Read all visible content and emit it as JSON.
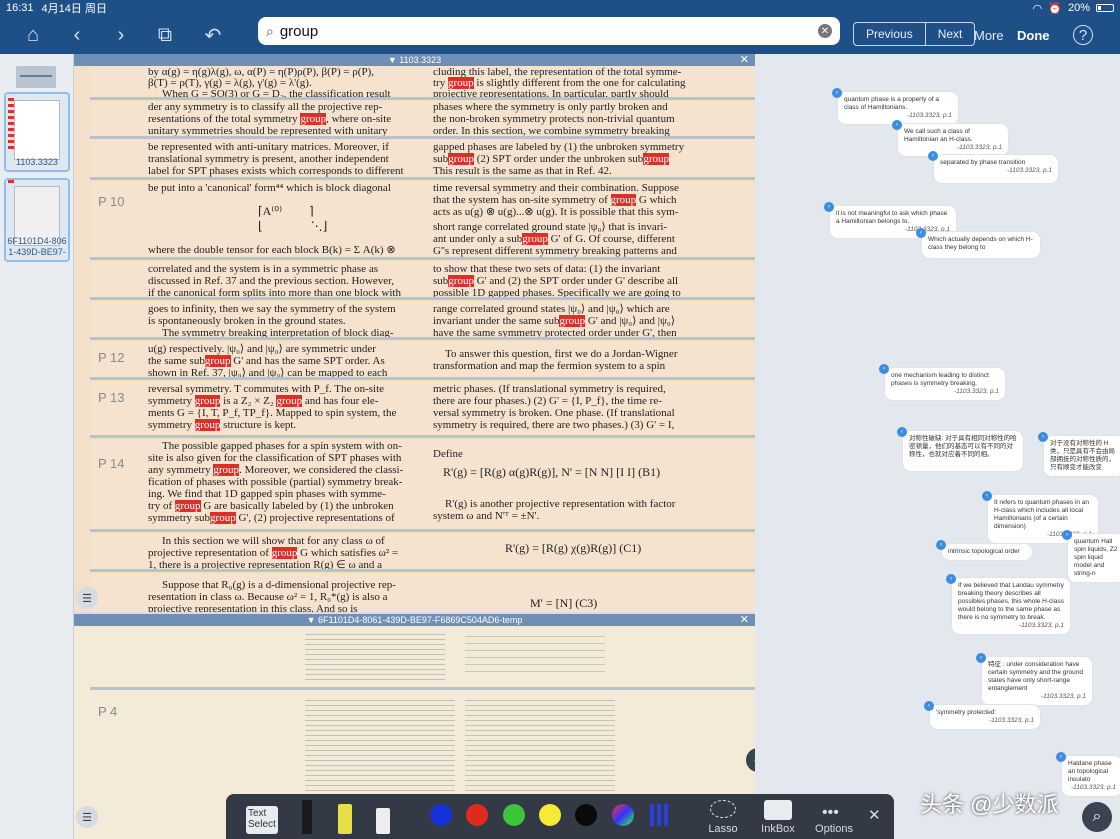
{
  "status": {
    "time": "16:31",
    "date": "4月14日 周日",
    "battery": "20%"
  },
  "toolbar": {
    "search_query": "group",
    "prev": "Previous",
    "next": "Next",
    "more": "More",
    "done": "Done"
  },
  "thumbs": [
    {
      "label": "1103.3323"
    },
    {
      "label": "6F1101D4-8061-439D-BE97-"
    }
  ],
  "pane1": {
    "title": "1103.3323"
  },
  "pane2": {
    "title": "6F1101D4-8061-439D-BE97-F6869C504AD6-temp"
  },
  "pages": {
    "p10": "P 10",
    "p12": "P 12",
    "p13": "P 13",
    "p14": "P 14",
    "p4": "P 4"
  },
  "pdf": {
    "s1a": "by α(g) = η(g)λ(g), ω, α(P) = η(P)ρ(P), β(P) = ρ(P),",
    "s1b": "β(T) = ρ(T), γ(g) = λ(g), γ'(g) = λ'(g).",
    "s1c": "When G = SO(3) or G = D₂, the classification result",
    "s2a": "der any symmetry is to classify all the projective rep-",
    "s2b": "resentations of the total symmetry",
    "s2b2": ", where on-site",
    "s2c": "unitary symmetries should be represented with unitary",
    "s3a": "be represented with anti-unitary matrices. Moreover, if",
    "s3b": "translational symmetry is present, another independent",
    "s3c": "label for SPT phases exists which corresponds to different",
    "s4a": "be put into a 'canonical' form⁴⁴ which is block diagonal",
    "s5a": "where the double tensor for each block B(k) = Σ A(k) ⊗",
    "s6a": "correlated and the system is in a symmetric phase as",
    "s6b": "discussed in Ref. 37 and the previous section. However,",
    "s6c": "if the canonical form splits into more than one block with",
    "s7a": "goes to infinity, then we say the symmetry of the system",
    "s7b": "is spontaneously broken in the ground states.",
    "s7c": "The symmetry breaking interpretation of block diag-",
    "s8a": "u(g) respectively. |ψ₀⟩ and |ψ₀⟩ are symmetric under",
    "s8b": "the same sub",
    "s8b2": " G' and has the same SPT order. As",
    "s8c": "shown in Ref. 37, |ψ₀⟩ and |ψ₀⟩ can be mapped to each",
    "s9a": "reversal symmetry.  T commutes with P_f. The on-site",
    "s9b": "symmetry",
    "s9b2": "is a Z₂ × Z₂",
    "s9b3": "and has four ele-",
    "s9c": "ments G = {I, T, P_f, TP_f}. Mapped to spin system, the",
    "s9d": "symmetry",
    "s9d2": "structure is kept.",
    "s9e": "The possible gapped phases for a spin system with on-",
    "s10a": "site is also given for the classification of SPT phases with",
    "s10b": "any symmetry",
    "s10b2": ". Moreover, we considered the classi-",
    "s10c": "fication of phases with possible (partial) symmetry break-",
    "s10d": "ing. We find that 1D gapped spin phases with symme-",
    "s10e": "try of",
    "s10e2": "G are basically labeled by (1) the unbroken",
    "s10f": "symmetry sub",
    "s10f2": "G', (2) projective representations of",
    "s10g": "G'. Note that in calculating projective representations of",
    "s11a": "In this section we will show that for any class ω of",
    "s11b": "projective representation of",
    "s11b2": "G which satisfies ω² =",
    "s11c": "1, there is a projective representation R(g) ∈ ω and a",
    "s12a": "Suppose that R₀(g) is a d-dimensional projective rep-",
    "s12b": "resentation in class ω. Because ω² = 1, R₀*(g) is also a",
    "s12c": "projective representation in this class. And so is",
    "r1a": "try",
    "r1a2": "is slightly different from the one for calculating",
    "r1b": "projective representations. In particular, partly should",
    "r2a": "phases where the symmetry is only partly broken and",
    "r2b": "the non-broken symmetry protects non-trivial quantum",
    "r2c": "order. In this section, we combine symmetry breaking",
    "r3a": "gapped phases are labeled by (1) the unbroken symmetry",
    "r3b": "sub",
    "r3b2": "(2) SPT order under the unbroken sub",
    "r3c": "This result is the same as that in Ref. 42.",
    "r4a": "time reversal symmetry and their combination. Suppose",
    "r4b": "that the system has on-site symmetry of",
    "r4b2": "G which",
    "r4c": "acts as u(g) ⊗ u(g)...⊗ u(g). It is possible that this sym-",
    "r5a": "short range correlated ground state |ψ₀⟩ that is invari-",
    "r5b": "ant under only a sub",
    "r5b2": "G' of G. Of course, different",
    "r5c": "G''s represent different symmetry breaking patterns and",
    "r6a": "to show that these two sets of data: (1) the invariant",
    "r6b": "sub",
    "r6b2": "G' and (2) the SPT order under G' describe all",
    "r6c": "possible 1D gapped phases. Specifically we are going to",
    "r7a": "range correlated ground states |ψ₀⟩ and |ψ₀⟩ which are",
    "r7b": "invariant under the same sub",
    "r7b2": "G' and |ψ₀⟩ and |ψ₀⟩",
    "r7c": "have the same symmetry protected order under G', then",
    "r8a": "To answer this question, first we do a Jordan-Wigner",
    "r8b": "transformation and map the fermion system to a spin",
    "r9a": "metric phases.  (If translational symmetry is required,",
    "r9b": "there are four phases.) (2) G' = {I, P_f}, the time re-",
    "r9c": "versal symmetry is broken. One phase. (If translational",
    "r9d": "symmetry is required, there are two phases.) (3) G' = I,",
    "r9e": "all symmetries are broken. One phase.",
    "r10a": "Define",
    "r10eq": "R'(g) = [R(g)  α(g)R(g)], N' = [N  N] [I  I]    (B1)",
    "r10b": "R'(g) is another projective representation with factor",
    "r10c": "system ω and N'ᵀ = ±N'.",
    "r11eq": "R'(g) = [R(g)  χ(g)R(g)]    (C1)",
    "r12eq": "M' = [N]    (C3)",
    "g": "group",
    "gp": "group"
  },
  "notes": [
    {
      "text": "quantum phase is a  property of a class of Hamiltonians.",
      "ref": "-1103.3323, p.1"
    },
    {
      "text": "We call such a class of Hamiltonian an H-class.",
      "ref": "-1103.3323, p.1"
    },
    {
      "text": "separated by phase transition",
      "ref": "-1103.3323, p.1"
    },
    {
      "text": "it is  not meaningful to ask which phase a Hamiltonian belongs  to.",
      "ref": "-1103.3323, p.1"
    },
    {
      "text": "Which actually depends on which H-class they belong to",
      "ref": ""
    },
    {
      "text": "one mechanism leading to distinct phases is symmetry breaking.",
      "ref": "-1103.3323, p.1"
    },
    {
      "text": "对称性破缺: 对于具有相同对称性的哈密顿量，他们的基态可以有不同的对称性，也就对应着不同的相。",
      "ref": ""
    },
    {
      "text": "对于没有对称性的 H 类，只是具有不会由局部拥抚的对称性质的，只有顺变才能改变",
      "ref": ""
    },
    {
      "text": "It refers  to quantum phases in an H-class which includes all local Hamiltonians (of a certain dimension)",
      "ref": "-1103.3323, p.1"
    },
    {
      "text": "intrinsic topological order",
      "ref": ""
    },
    {
      "text": "quantum Hall  spin liquids, Z2 spin liquid model and string-n",
      "ref": ""
    },
    {
      "text": "If we believed  that Landau symmetry breaking theory describes all possibles phases, this whole H-class would belong to the same  phase as there is no symmetry to break.",
      "ref": "-1103.3323, p.1"
    },
    {
      "text": "特征 : under consideration have certain symmetry and the ground states  have only short-range entanglement",
      "ref": "-1103.3323, p.1"
    },
    {
      "text": "'symmetry protected'",
      "ref": "-1103.3323, p.1"
    },
    {
      "text": "Haldane phase an topological insulato",
      "ref": "-1103.3323, p.1"
    }
  ],
  "bottom": {
    "text_select": "Text Select",
    "lasso": "Lasso",
    "inkbox": "InkBox",
    "options": "Options"
  },
  "watermark": "头条 @少数派",
  "colors": {
    "bar": "#1e4f86",
    "highlight": "#d9302a",
    "paper": "#f5e3cf"
  }
}
